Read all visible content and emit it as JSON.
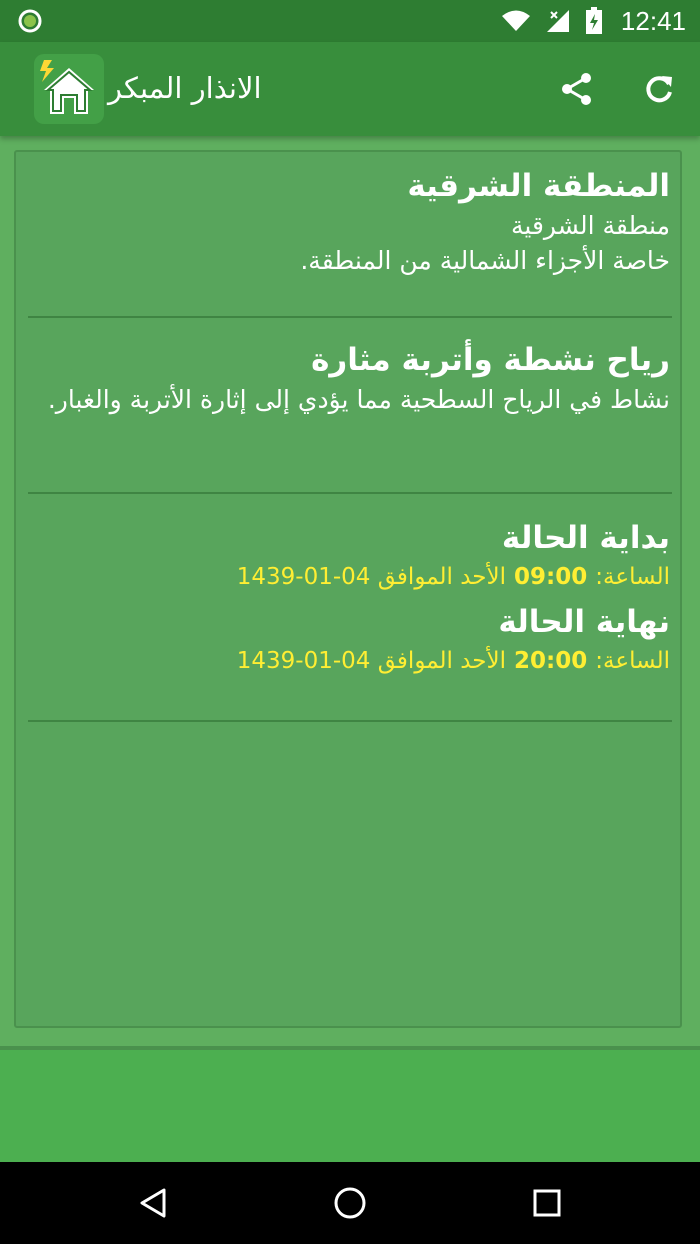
{
  "status_bar": {
    "time": "12:41",
    "icons": [
      "notification-dot-icon",
      "wifi-icon",
      "signal-icon",
      "battery-icon"
    ]
  },
  "app_bar": {
    "title": "الانذار المبكر",
    "logo_icon": "house-lightning-icon",
    "actions": [
      "share-icon",
      "refresh-icon"
    ]
  },
  "alert": {
    "region_title": "المنطقة الشرقية",
    "region_line1": "منطقة الشرقية",
    "region_line2": "خاصة الأجزاء الشمالية من المنطقة.",
    "type_title": "رياح نشطة وأتربة مثارة",
    "type_desc": "نشاط في الرياح السطحية مما يؤدي إلى إثارة الأتربة والغبار.",
    "start": {
      "title": "بداية الحالة",
      "label": "الساعة:",
      "time": "09:00",
      "rest": "الأحد الموافق 04-01-1439"
    },
    "end": {
      "title": "نهاية الحالة",
      "label": "الساعة:",
      "time": "20:00",
      "rest": "الأحد الموافق 04-01-1439"
    }
  },
  "nav_bar": {
    "buttons": [
      "back-icon",
      "home-icon",
      "recents-icon"
    ]
  },
  "colors": {
    "status_bar": "#2e7d32",
    "app_bar": "#388e3c",
    "background": "#5faf5f",
    "card": "#58a55c",
    "highlight_text": "#ffee33"
  }
}
